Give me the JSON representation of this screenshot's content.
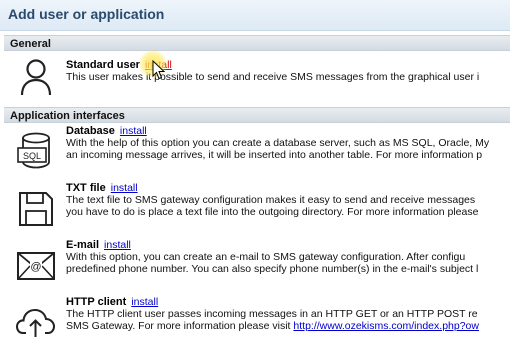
{
  "window": {
    "title": "Add user or application"
  },
  "sections": {
    "general": "General",
    "app_interfaces": "Application interfaces"
  },
  "items": [
    {
      "name": "Standard user",
      "install": "install",
      "lines": [
        "This user makes it possible to send and receive SMS messages from the graphical user i"
      ]
    },
    {
      "name": "Database",
      "install": "install",
      "lines": [
        "With the help of this option you can create a database server, such as MS SQL, Oracle, My",
        "an incoming message arrives, it will be inserted into another table. For more information p"
      ]
    },
    {
      "name": "TXT file",
      "install": "install",
      "lines": [
        "The text file to SMS gateway configuration makes it easy to send and receive messages",
        "you have to do is place a text file into the outgoing directory. For more information please"
      ]
    },
    {
      "name": "E-mail",
      "install": "install",
      "lines": [
        "With this option, you can create an e-mail to SMS gateway configuration. After configu",
        "predefined phone number. You can also specify phone number(s) in the e-mail's subject l"
      ]
    },
    {
      "name": "HTTP client",
      "install": "install",
      "lines": [
        "The HTTP client user passes incoming messages in an HTTP GET or an HTTP POST re"
      ],
      "last_line_prefix": "SMS Gateway. For more information please visit ",
      "last_line_link": "http://www.ozekisms.com/index.php?ow"
    }
  ],
  "icons": [
    "user-icon",
    "database-sql-icon",
    "floppy-disk-icon",
    "envelope-at-icon",
    "cloud-upload-icon"
  ]
}
